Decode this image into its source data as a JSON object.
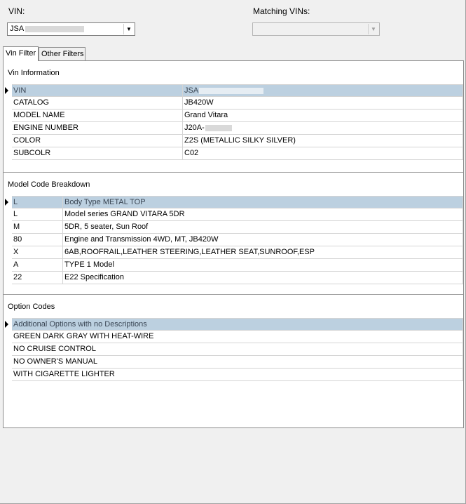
{
  "vin_field": {
    "label": "VIN:",
    "value": "JSA"
  },
  "matching_vins": {
    "label": "Matching VINs:",
    "value": ""
  },
  "tabs": [
    {
      "label": "Vin Filter",
      "active": true
    },
    {
      "label": "Other Filters",
      "active": false
    }
  ],
  "vin_information": {
    "title": "Vin Information",
    "rows": [
      {
        "key": "VIN",
        "value": "JSA"
      },
      {
        "key": "CATALOG",
        "value": "JB420W"
      },
      {
        "key": "MODEL NAME",
        "value": "Grand Vitara"
      },
      {
        "key": "ENGINE NUMBER",
        "value": "J20A-"
      },
      {
        "key": "COLOR",
        "value": "Z2S (METALLIC SILKY SILVER)"
      },
      {
        "key": "SUBCOLR",
        "value": "C02"
      }
    ]
  },
  "model_code_breakdown": {
    "title": "Model Code Breakdown",
    "rows": [
      {
        "code": "L",
        "description": "Body Type METAL TOP"
      },
      {
        "code": "L",
        "description": "Model series GRAND VITARA 5DR"
      },
      {
        "code": "M",
        "description": "5DR, 5 seater, Sun Roof"
      },
      {
        "code": "80",
        "description": "Engine and Transmission 4WD, MT, JB420W"
      },
      {
        "code": "X",
        "description": "6AB,ROOFRAIL,LEATHER STEERING,LEATHER SEAT,SUNROOF,ESP"
      },
      {
        "code": "A",
        "description": "TYPE 1 Model"
      },
      {
        "code": "22",
        "description": "E22 Specification"
      }
    ]
  },
  "option_codes": {
    "title": "Option Codes",
    "rows": [
      "Additional Options with no Descriptions",
      "GREEN DARK GRAY WITH HEAT-WIRE",
      "NO CRUISE CONTROL",
      "NO OWNER'S MANUAL",
      "WITH CIGARETTE LIGHTER"
    ]
  },
  "colors": {
    "selected_row": "#bcd0e0",
    "window_bg": "#f0f0f0",
    "panel_bg": "#ffffff"
  }
}
